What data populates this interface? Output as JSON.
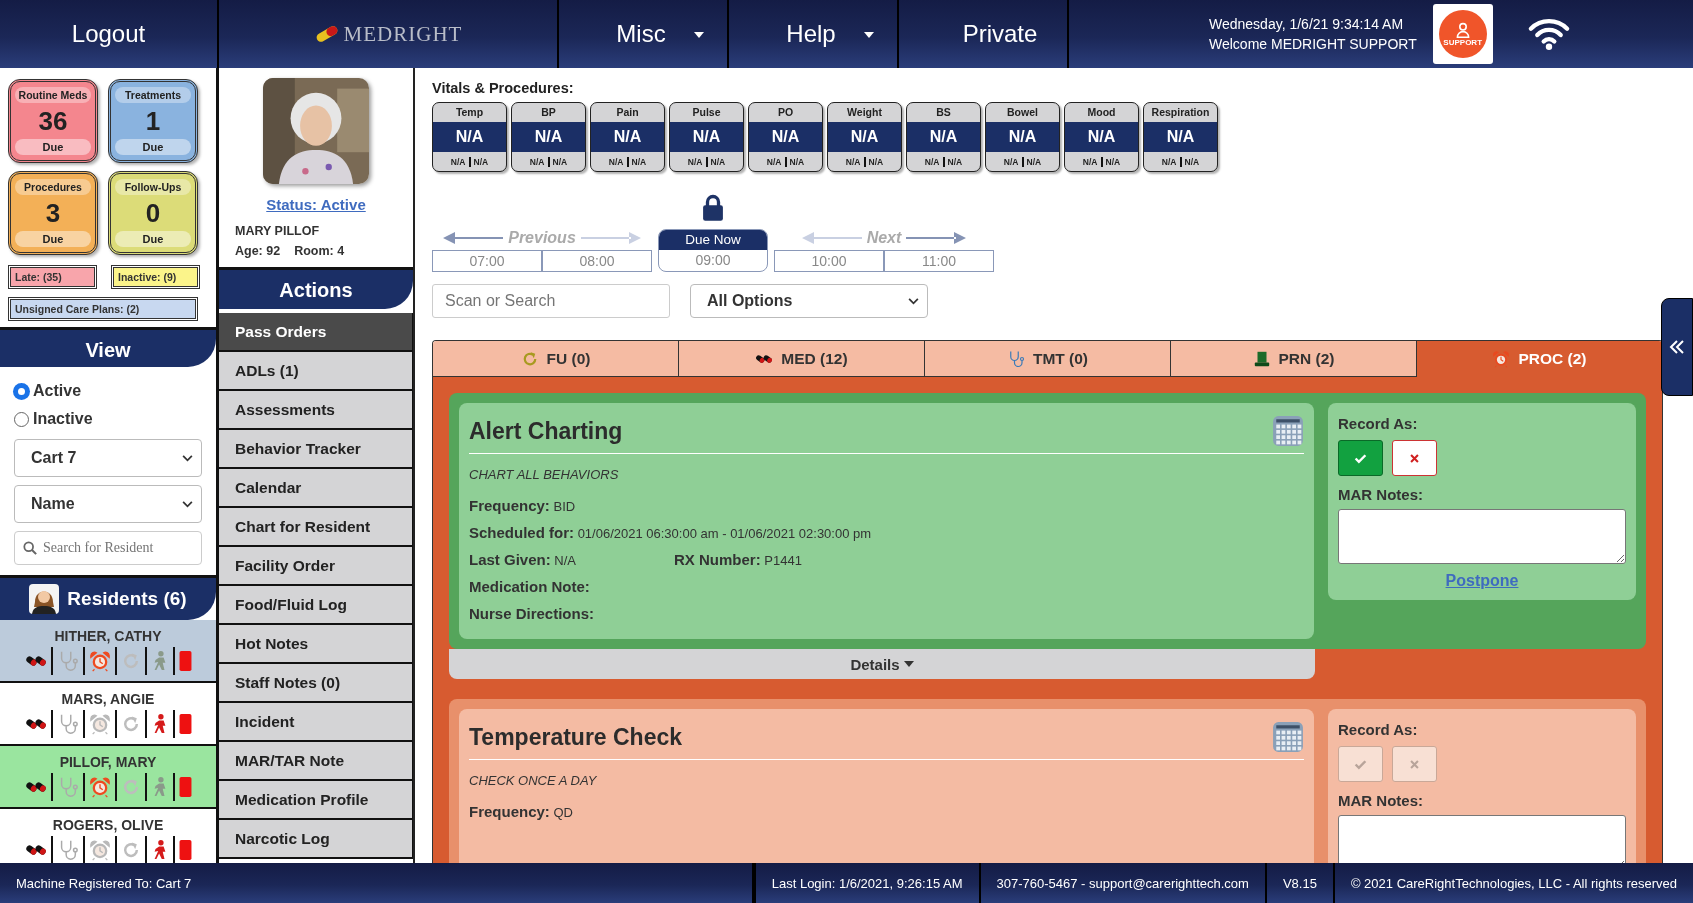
{
  "header": {
    "logout": "Logout",
    "logo": "MEDRIGHT",
    "menus": [
      {
        "label": "Misc",
        "dropdown": true
      },
      {
        "label": "Help",
        "dropdown": true
      },
      {
        "label": "Private",
        "dropdown": false
      }
    ],
    "datetime": "Wednesday, 1/6/21 9:34:14 AM",
    "welcome": "Welcome MEDRIGHT SUPPORT",
    "support_label": "SUPPORT"
  },
  "due_tiles": [
    {
      "label": "Routine Meds",
      "count": "36",
      "due": "Due",
      "color": "#f4868e"
    },
    {
      "label": "Treatments",
      "count": "1",
      "due": "Due",
      "color": "#8ab3df"
    },
    {
      "label": "Procedures",
      "count": "3",
      "due": "Due",
      "color": "#f3b057"
    },
    {
      "label": "Follow-Ups",
      "count": "0",
      "due": "Due",
      "color": "#dcdc78"
    }
  ],
  "flags": [
    {
      "label": "Late: (35)",
      "color": "#f8a5ab"
    },
    {
      "label": "Inactive: (9)",
      "color": "#fbf48a"
    },
    {
      "label": "Unsigned Care Plans: (2)",
      "color": "#c8d8f0"
    }
  ],
  "view": {
    "title": "View",
    "filters": [
      {
        "label": "Active",
        "selected": true
      },
      {
        "label": "Inactive",
        "selected": false
      }
    ],
    "cart": "Cart 7",
    "sort": "Name",
    "search_placeholder": "Search for Resident"
  },
  "residents_title": "Residents (6)",
  "residents": [
    {
      "name": "HITHER, CATHY",
      "selected": false,
      "highlighted": true,
      "alarm": true,
      "person_alert": false
    },
    {
      "name": "MARS, ANGIE",
      "selected": false,
      "highlighted": false,
      "alarm": false,
      "person_alert": true
    },
    {
      "name": "PILLOF, MARY",
      "selected": true,
      "highlighted": false,
      "alarm": true,
      "person_alert": false
    },
    {
      "name": "ROGERS, OLIVE",
      "selected": false,
      "highlighted": false,
      "alarm": false,
      "person_alert": true
    }
  ],
  "profile": {
    "kind": "picture",
    "status": "Status: Active",
    "name": "MARY PILLOF",
    "age": "Age: 92",
    "room": "Room: 4"
  },
  "actions": {
    "title": "Actions",
    "items": [
      {
        "label": "Pass Orders",
        "selected": true
      },
      {
        "label": "ADLs (1)",
        "selected": false
      },
      {
        "label": "Assessments",
        "selected": false
      },
      {
        "label": "Behavior Tracker",
        "selected": false
      },
      {
        "label": "Calendar",
        "selected": false
      },
      {
        "label": "Chart for Resident",
        "selected": false
      },
      {
        "label": "Facility Order",
        "selected": false
      },
      {
        "label": "Food/Fluid Log",
        "selected": false
      },
      {
        "label": "Hot Notes",
        "selected": false
      },
      {
        "label": "Staff Notes (0)",
        "selected": false
      },
      {
        "label": "Incident",
        "selected": false
      },
      {
        "label": "MAR/TAR Note",
        "selected": false
      },
      {
        "label": "Medication Profile",
        "selected": false
      },
      {
        "label": "Narcotic Log",
        "selected": false
      }
    ]
  },
  "vitals": {
    "title": "Vitals & Procedures:",
    "items": [
      {
        "label": "Temp",
        "value": "N/A",
        "low": "N/A",
        "high": "N/A"
      },
      {
        "label": "BP",
        "value": "N/A",
        "low": "N/A",
        "high": "N/A"
      },
      {
        "label": "Pain",
        "value": "N/A",
        "low": "N/A",
        "high": "N/A"
      },
      {
        "label": "Pulse",
        "value": "N/A",
        "low": "N/A",
        "high": "N/A"
      },
      {
        "label": "PO",
        "value": "N/A",
        "low": "N/A",
        "high": "N/A"
      },
      {
        "label": "Weight",
        "value": "N/A",
        "low": "N/A",
        "high": "N/A"
      },
      {
        "label": "BS",
        "value": "N/A",
        "low": "N/A",
        "high": "N/A"
      },
      {
        "label": "Bowel",
        "value": "N/A",
        "low": "N/A",
        "high": "N/A"
      },
      {
        "label": "Mood",
        "value": "N/A",
        "low": "N/A",
        "high": "N/A"
      },
      {
        "label": "Respiration",
        "value": "N/A",
        "low": "N/A",
        "high": "N/A"
      }
    ]
  },
  "timeline": {
    "previous": "Previous",
    "next": "Next",
    "due_label": "Due Now",
    "locked": true,
    "slots": [
      {
        "time": "07:00",
        "selected": false
      },
      {
        "time": "08:00",
        "selected": false
      },
      {
        "time": "09:00",
        "selected": true
      },
      {
        "time": "10:00",
        "selected": false
      },
      {
        "time": "11:00",
        "selected": false
      }
    ]
  },
  "filter": {
    "search_placeholder": "Scan or Search",
    "option": "All Options"
  },
  "tabs": [
    {
      "label": "FU (0)",
      "kind": "followup",
      "selected": false
    },
    {
      "label": "MED (12)",
      "kind": "med",
      "selected": false
    },
    {
      "label": "TMT (0)",
      "kind": "treatment",
      "selected": false
    },
    {
      "label": "PRN (2)",
      "kind": "prn",
      "selected": false
    },
    {
      "label": "PROC (2)",
      "kind": "procedure",
      "selected": true
    }
  ],
  "cards": [
    {
      "title": "Alert Charting",
      "enabled": true,
      "instructions": "CHART ALL BEHAVIORS",
      "fields": [
        {
          "label": "Frequency:",
          "value": "BID"
        },
        {
          "label": "Scheduled for:",
          "value": "01/06/2021 06:30:00 am - 01/06/2021 02:30:00 pm"
        },
        {
          "label": "Last Given:",
          "value": "N/A",
          "extra_label": "RX Number:",
          "extra_value": "P1441"
        },
        {
          "label": "Medication Note:"
        },
        {
          "label": "Nurse Directions:"
        }
      ],
      "record_label": "Record As:",
      "notes_label": "MAR Notes:",
      "postpone": "Postpone",
      "details": "Details"
    },
    {
      "title": "Temperature Check",
      "enabled": false,
      "instructions": "CHECK ONCE A DAY",
      "fields": [
        {
          "label": "Frequency:",
          "value": "QD"
        }
      ],
      "record_label": "Record As:",
      "notes_label": "MAR Notes:"
    }
  ],
  "footer": [
    "Machine Registered To: Cart 7",
    "Last Login: 1/6/2021, 9:26:15 AM",
    "307-760-5467 - support@carerighttech.com",
    "V8.15",
    "© 2021 CareRightTechnologies, LLC - All rights reserved"
  ]
}
